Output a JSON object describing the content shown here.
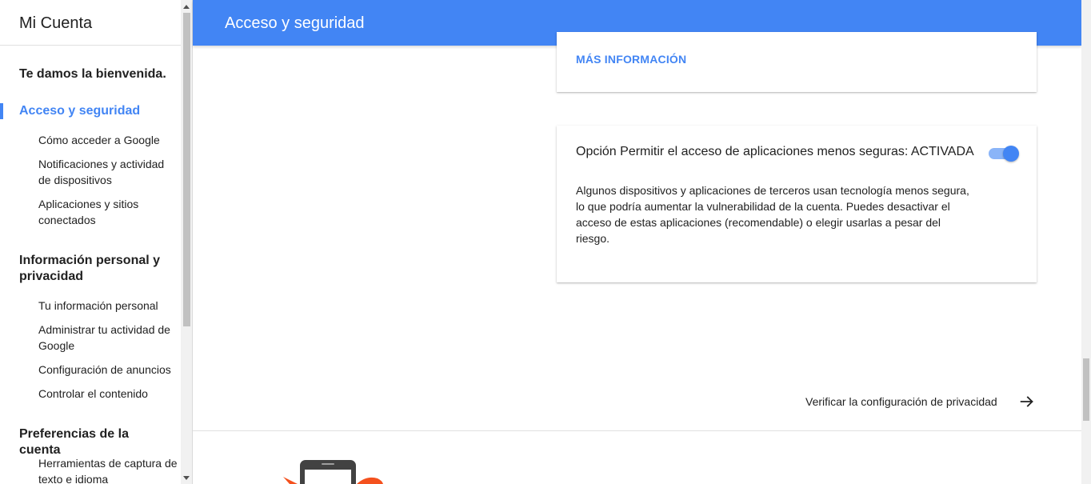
{
  "sidebar": {
    "title": "Mi Cuenta",
    "welcome": "Te damos la bienvenida.",
    "sections": [
      {
        "label": "Acceso y seguridad",
        "active": true,
        "items": [
          "Cómo acceder a Google",
          "Notificaciones y actividad de dispositivos",
          "Aplicaciones y sitios conectados"
        ]
      },
      {
        "label": "Información personal y privacidad",
        "items": [
          "Tu información personal",
          "Administrar tu actividad de Google",
          "Configuración de anuncios",
          "Controlar el contenido"
        ]
      },
      {
        "label": "Preferencias de la cuenta",
        "items": [
          "Herramientas de captura de texto e idioma"
        ]
      }
    ]
  },
  "header": {
    "title": "Acceso y seguridad",
    "color": "#4285f4"
  },
  "cards": {
    "more_info": "MÁS INFORMACIÓN",
    "less_secure_apps": {
      "title": "Opción Permitir el acceso de aplicaciones menos seguras: ACTIVADA",
      "description": "Algunos dispositivos y aplicaciones de terceros usan tecnología menos segura, lo que podría aumentar la vulnerabilidad de la cuenta. Puedes desactivar el acceso de estas aplicaciones (recomendable) o elegir usarlas a pesar del riesgo.",
      "toggle_on": true
    }
  },
  "privacy_link": {
    "label": "Verificar la configuración de privacidad",
    "icon": "arrow-right-icon"
  },
  "colors": {
    "accent": "#4285f4",
    "illustration_orange": "#f4511e"
  }
}
